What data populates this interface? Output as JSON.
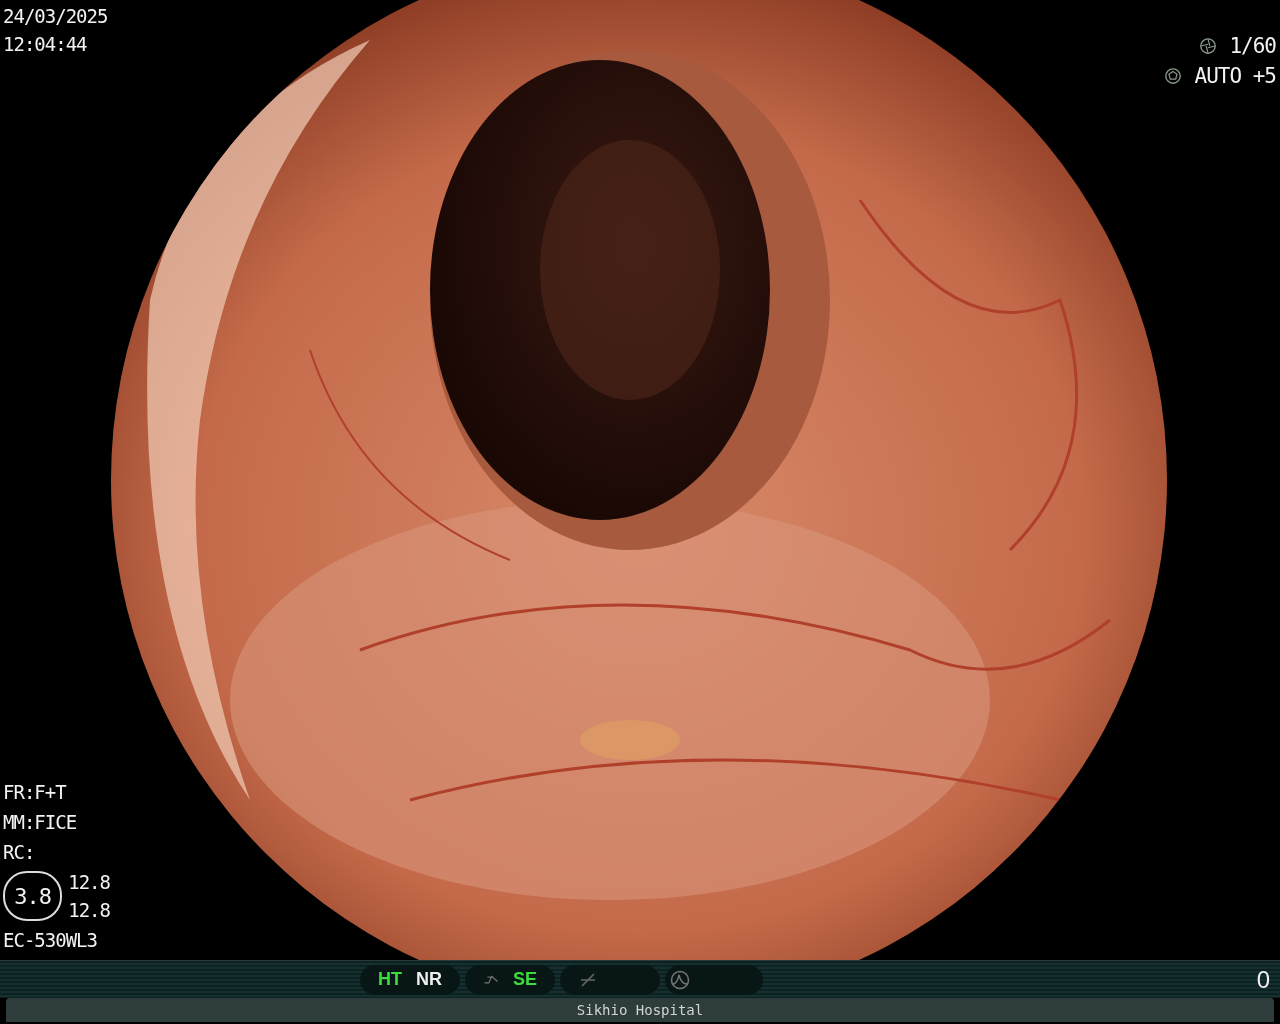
{
  "datetime": {
    "date": "24/03/2025",
    "time": "12:04:44"
  },
  "camera": [
    {
      "kind": "shutter",
      "value": "1/60"
    },
    {
      "kind": "iris",
      "value": "AUTO +5"
    }
  ],
  "settings": [
    "FR:F+T",
    "MM:FICE",
    "RC:"
  ],
  "gauge": {
    "value": "3.8",
    "readings": [
      "12.8",
      "12.8"
    ]
  },
  "scope_model": "EC-530WL3",
  "status_groups": [
    {
      "items": [
        {
          "kind": "label",
          "label": "HT",
          "on": true
        },
        {
          "kind": "label",
          "label": "NR",
          "on": false
        }
      ]
    },
    {
      "items": [
        {
          "kind": "curve"
        },
        {
          "kind": "label",
          "label": "SE",
          "on": true
        }
      ]
    },
    {
      "items": [
        {
          "kind": "step"
        }
      ]
    },
    {
      "items": [
        {
          "kind": "peak"
        }
      ]
    }
  ],
  "counter": "0",
  "footer": "Sikhio Hospital"
}
